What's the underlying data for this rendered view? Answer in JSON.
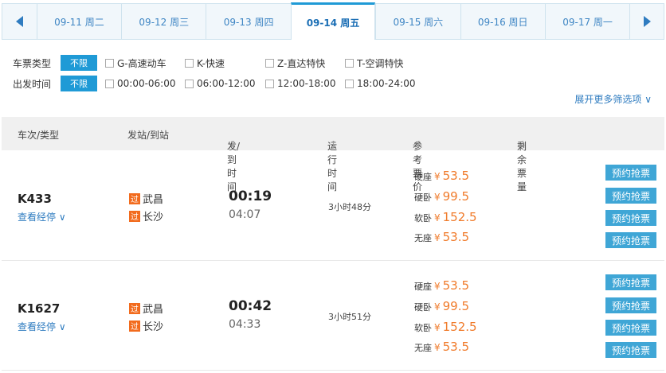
{
  "dates": [
    {
      "label": "09-11 周二"
    },
    {
      "label": "09-12 周三"
    },
    {
      "label": "09-13 周四"
    },
    {
      "label": "09-14 周五",
      "active": true
    },
    {
      "label": "09-15 周六"
    },
    {
      "label": "09-16 周日"
    },
    {
      "label": "09-17 周一"
    }
  ],
  "filters": {
    "type_label": "车票类型",
    "time_label": "出发时间",
    "no_limit": "不限",
    "types": [
      "G-高速动车",
      "K-快速",
      "Z-直达特快",
      "T-空调特快"
    ],
    "times": [
      "00:00-06:00",
      "06:00-12:00",
      "12:00-18:00",
      "18:00-24:00"
    ],
    "more": "展开更多筛选项 ∨"
  },
  "table_header": {
    "train": "车次/类型",
    "station": "发站/到站",
    "time": "发/到时间",
    "duration": "运行时间",
    "price": "参考票价",
    "remaining": "剩余票量"
  },
  "trains": [
    {
      "no": "K433",
      "stops_link": "查看经停 ∨",
      "from": "武昌",
      "to": "长沙",
      "badge": "过",
      "dep": "00:19",
      "arr": "04:07",
      "duration": "3小时48分",
      "prices": [
        {
          "seat": "硬座",
          "yen": "¥",
          "amount": "53.5"
        },
        {
          "seat": "硬卧",
          "yen": "¥",
          "amount": "99.5"
        },
        {
          "seat": "软卧",
          "yen": "¥",
          "amount": "152.5"
        },
        {
          "seat": "无座",
          "yen": "¥",
          "amount": "53.5"
        }
      ],
      "button": "预约抢票"
    },
    {
      "no": "K1627",
      "stops_link": "查看经停 ∨",
      "from": "武昌",
      "to": "长沙",
      "badge": "过",
      "dep": "00:42",
      "arr": "04:33",
      "duration": "3小时51分",
      "prices": [
        {
          "seat": "硬座",
          "yen": "¥",
          "amount": "53.5"
        },
        {
          "seat": "硬卧",
          "yen": "¥",
          "amount": "99.5"
        },
        {
          "seat": "软卧",
          "yen": "¥",
          "amount": "152.5"
        },
        {
          "seat": "无座",
          "yen": "¥",
          "amount": "53.5"
        }
      ],
      "button": "预约抢票"
    }
  ],
  "colors": {
    "accent": "#1f9ad6",
    "price": "#f07b2b",
    "badge": "#f26b1d"
  }
}
